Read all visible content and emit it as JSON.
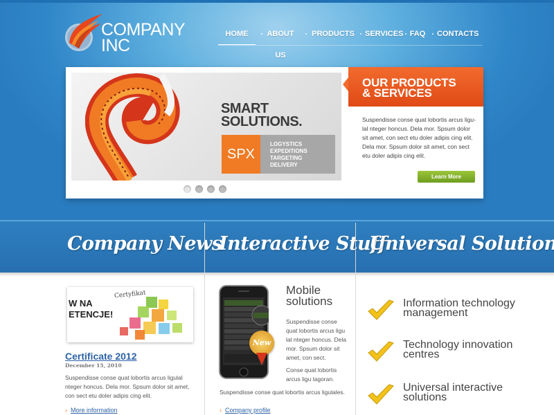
{
  "logo": {
    "line1": "COMPANY",
    "line2": "INC"
  },
  "nav": {
    "items": [
      {
        "label": "HOME",
        "active": true
      },
      {
        "label": "ABOUT US",
        "active": false
      },
      {
        "label": "PRODUCTS",
        "active": false
      },
      {
        "label": "SERVICES",
        "active": false
      },
      {
        "label": "FAQ",
        "active": false
      },
      {
        "label": "CONTACTS",
        "active": false
      }
    ]
  },
  "hero": {
    "headline_line1": "SMART",
    "headline_line2": "SOLUTIONS.",
    "badge": "SPX",
    "services": [
      "LOGYSTICS",
      "EXPEDITIONS",
      "TARGETING",
      "DELIVERY"
    ],
    "slides": 4,
    "active_slide": 1
  },
  "products": {
    "title_line1": "OUR PRODUCTS",
    "title_line2": "& SERVICES",
    "text": "Suspendisse conse quat lobortis arcus ligu-lal nteger honcus. Dela mor. Spsum dolor sit amet, con sect etu doler  adipis cing elit. Dela mor. Spsum dolor sit amet, con sect etu doler adipis cing elit.",
    "button": "Learn More"
  },
  "sections": {
    "news_title": "Company News",
    "interactive_title": "Interactive Stuff",
    "solutions_title": "Universal Solutions"
  },
  "news": {
    "title": "Certificate 2012",
    "date": "December 15, 2010",
    "text": "Suspendisse conse quat lobortis arcus ligulal nteger honcus. Dela mor. Spsum dolor sit amet, con sect etu doler adipis cing elit.",
    "link": "More information",
    "image_text": {
      "top": "Certyfikat",
      "line1": "W NA",
      "line2": "ETENCJE!"
    }
  },
  "interactive": {
    "title_line1": "Mobile",
    "title_line2": "solutions",
    "text1": "Suspendisse conse quat lobortis arcus ligu lal nteger honcus. Dela mor. Spsum dolor sit amet, con sect.",
    "text2": "Conse quat lobortis arcus ligu lagoran.",
    "text3": "Suspendisse conse quat lobortis arcus ligulales.",
    "badge": "New",
    "link": "Company profile"
  },
  "solutions": {
    "items": [
      {
        "line1": "Information technology",
        "line2": "management"
      },
      {
        "line1": "Technology innovation",
        "line2": "centres"
      },
      {
        "line1": "Universal interactive",
        "line2": "solutions"
      }
    ]
  },
  "colors": {
    "accent_orange": "#f07b24",
    "brand_blue": "#2f7fbf",
    "button_green": "#7aab26",
    "check_yellow": "#f2c21b",
    "link_blue": "#2d62a7"
  }
}
